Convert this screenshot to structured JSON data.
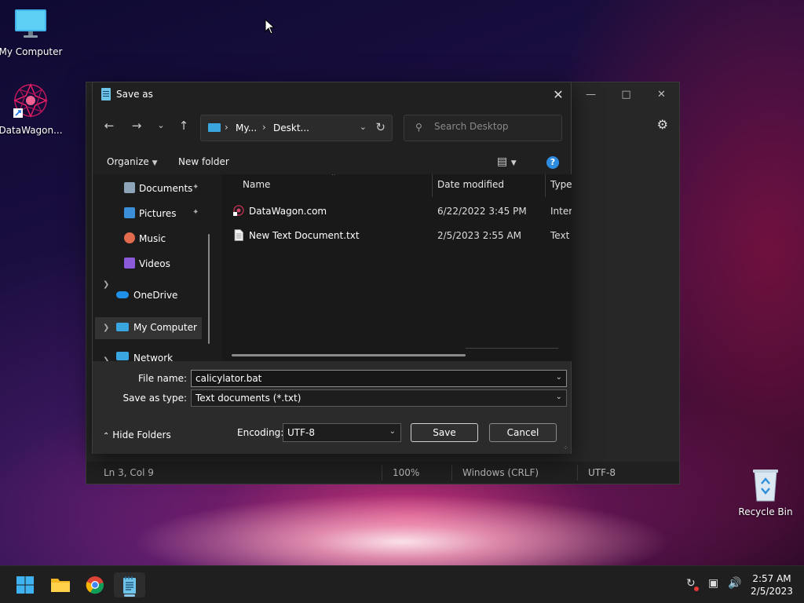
{
  "desktop": {
    "icons": [
      {
        "label": "My Computer"
      },
      {
        "label": "DataWagon..."
      }
    ],
    "recycle_bin": {
      "label": "Recycle Bin"
    }
  },
  "notepad": {
    "status": {
      "position": "Ln 3, Col 9",
      "zoom": "100%",
      "line_endings": "Windows (CRLF)",
      "encoding": "UTF-8"
    }
  },
  "dialog": {
    "title": "Save as",
    "breadcrumb": [
      "My...",
      "Deskt..."
    ],
    "search_placeholder": "Search Desktop",
    "commands": {
      "organize": "Organize",
      "new_folder": "New folder"
    },
    "nav_items": [
      {
        "label": "Documents",
        "pinned": true
      },
      {
        "label": "Pictures",
        "pinned": true
      },
      {
        "label": "Music"
      },
      {
        "label": "Videos"
      },
      {
        "label": "OneDrive"
      },
      {
        "label": "My Computer",
        "selected": true
      },
      {
        "label": "Network"
      }
    ],
    "columns": {
      "name": "Name",
      "date": "Date modified",
      "type": "Type"
    },
    "files": [
      {
        "name": "DataWagon.com",
        "date": "6/22/2022 3:45 PM",
        "type": "Intern"
      },
      {
        "name": "New Text Document.txt",
        "date": "2/5/2023 2:55 AM",
        "type": "Text D"
      }
    ],
    "file_name_label": "File name:",
    "file_name_value": "calicylator.bat",
    "save_type_label": "Save as type:",
    "save_type_value": "Text documents (*.txt)",
    "hide_folders": "Hide Folders",
    "encoding_label": "Encoding:",
    "encoding_value": "UTF-8",
    "save_button": "Save",
    "cancel_button": "Cancel"
  },
  "taskbar": {
    "clock_time": "2:57 AM",
    "clock_date": "2/5/2023"
  }
}
